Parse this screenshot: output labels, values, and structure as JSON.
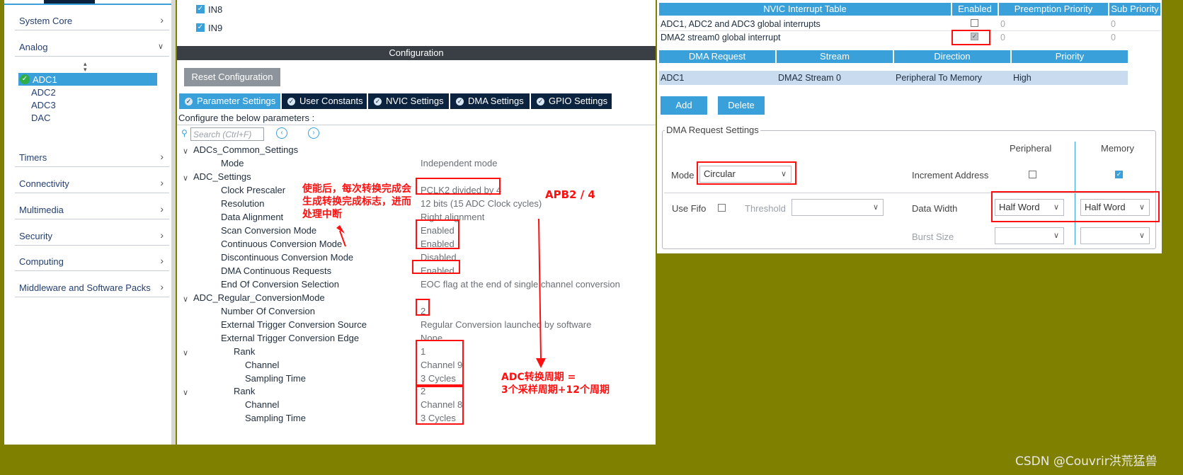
{
  "sidebar": {
    "categories": [
      "System Core",
      "Analog",
      "Timers",
      "Connectivity",
      "Multimedia",
      "Security",
      "Computing",
      "Middleware and Software Packs"
    ],
    "analog_items": [
      "ADC1",
      "ADC2",
      "ADC3",
      "DAC"
    ]
  },
  "pins": [
    "IN8",
    "IN9"
  ],
  "configuration": {
    "title": "Configuration",
    "reset_button": "Reset Configuration",
    "tabs": [
      "Parameter Settings",
      "User Constants",
      "NVIC Settings",
      "DMA Settings",
      "GPIO Settings"
    ],
    "configure_label": "Configure the below parameters :",
    "search_placeholder": "Search (Ctrl+F)"
  },
  "params": {
    "common_group": "ADCs_Common_Settings",
    "mode_label": "Mode",
    "mode_value": "Independent mode",
    "adc_group": "ADC_Settings",
    "adc_settings": [
      {
        "label": "Clock Prescaler",
        "value": "PCLK2 divided by 4"
      },
      {
        "label": "Resolution",
        "value": "12 bits (15 ADC Clock cycles)"
      },
      {
        "label": "Data Alignment",
        "value": "Right alignment"
      },
      {
        "label": "Scan Conversion Mode",
        "value": "Enabled"
      },
      {
        "label": "Continuous Conversion Mode",
        "value": "Enabled"
      },
      {
        "label": "Discontinuous Conversion Mode",
        "value": "Disabled"
      },
      {
        "label": "DMA Continuous Requests",
        "value": "Enabled"
      },
      {
        "label": "End Of Conversion Selection",
        "value": "EOC flag at the end of single channel conversion"
      }
    ],
    "regular_group": "ADC_Regular_ConversionMode",
    "regular_settings": [
      {
        "label": "Number Of Conversion",
        "value": "2"
      },
      {
        "label": "External Trigger Conversion Source",
        "value": "Regular Conversion launched by software"
      },
      {
        "label": "External Trigger Conversion Edge",
        "value": "None"
      }
    ],
    "rank_label": "Rank",
    "channel_label": "Channel",
    "sampling_label": "Sampling Time",
    "ranks": [
      {
        "rank": "1",
        "channel": "Channel 9",
        "sampling": "3 Cycles"
      },
      {
        "rank": "2",
        "channel": "Channel 8",
        "sampling": "3 Cycles"
      }
    ]
  },
  "annotations": {
    "eoc_note_line1": "使能后，每次转换完成会",
    "eoc_note_line2": "生成转换完成标志，进而",
    "eoc_note_line3": "处理中断",
    "apb": "APB2 / 4",
    "period_line1": "ADC转换周期 =",
    "period_line2": "3个采样周期+12个周期"
  },
  "nvic": {
    "headers": [
      "NVIC Interrupt Table",
      "Enabled",
      "Preemption Priority",
      "Sub Priority"
    ],
    "rows": [
      {
        "name": "ADC1, ADC2 and ADC3 global interrupts",
        "preempt": "0",
        "sub": "0",
        "enabled": false
      },
      {
        "name": "DMA2 stream0 global interrupt",
        "preempt": "0",
        "sub": "0",
        "enabled": true
      }
    ]
  },
  "dma": {
    "headers": [
      "DMA Request",
      "Stream",
      "Direction",
      "Priority"
    ],
    "row": [
      "ADC1",
      "DMA2 Stream 0",
      "Peripheral To Memory",
      "High"
    ],
    "add_button": "Add",
    "delete_button": "Delete",
    "settings_legend": "DMA Request Settings",
    "peripheral_header": "Peripheral",
    "memory_header": "Memory",
    "mode_label": "Mode",
    "mode_value": "Circular",
    "increment_label": "Increment Address",
    "use_fifo_label": "Use Fifo",
    "threshold_label": "Threshold",
    "data_width_label": "Data Width",
    "peripheral_width": "Half Word",
    "memory_width": "Half Word",
    "burst_size_label": "Burst Size"
  },
  "watermark": "CSDN @Couvrir洪荒猛兽",
  "colors": {
    "accent": "#39a0d9",
    "tab_dark": "#0c2340",
    "annotation": "#ff1010",
    "background": "#808000"
  }
}
